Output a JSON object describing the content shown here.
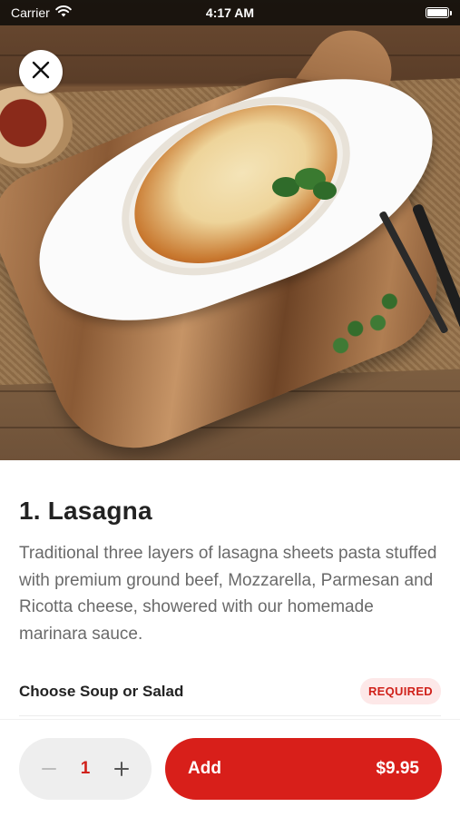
{
  "status_bar": {
    "carrier": "Carrier",
    "time": "4:17 AM",
    "wifi_icon": "wifi-icon",
    "battery_icon": "battery-icon",
    "battery_level": 1.0
  },
  "hero": {
    "image_subject": "lasagna-dish-photo",
    "close_icon": "close-icon"
  },
  "item": {
    "title": "1. Lasagna",
    "description": "Traditional three layers of lasagna sheets pasta stuffed with premium ground beef, Mozzarella, Parmesan and Ricotta cheese, showered with our homemade marinara sauce."
  },
  "options": [
    {
      "label": "Choose Soup or Salad",
      "badge": "REQUIRED"
    }
  ],
  "cart": {
    "quantity": "1",
    "minus_icon": "minus-icon",
    "plus_icon": "plus-icon",
    "add_label": "Add",
    "price": "$9.95"
  },
  "colors": {
    "accent": "#d81f1a",
    "badge_bg": "#fde8e8",
    "stepper_bg": "#eeeeee"
  }
}
